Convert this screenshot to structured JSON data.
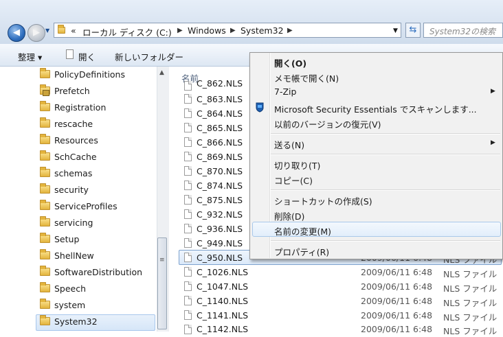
{
  "address": {
    "crumbs": [
      "«",
      "ローカル ディスク (C:)",
      "Windows",
      "System32"
    ],
    "search_placeholder": "System32の検索"
  },
  "toolbar": {
    "organize": "整理 ▾",
    "open": "開く",
    "new_folder": "新しいフォルダー"
  },
  "nav": {
    "items": [
      "PolicyDefinitions",
      "Prefetch",
      "Registration",
      "rescache",
      "Resources",
      "SchCache",
      "schemas",
      "security",
      "ServiceProfiles",
      "servicing",
      "Setup",
      "ShellNew",
      "SoftwareDistribution",
      "Speech",
      "system",
      "System32"
    ],
    "selected": "System32"
  },
  "files": {
    "column_name": "名前",
    "rows": [
      {
        "name": "C_862.NLS",
        "date": "",
        "type": ""
      },
      {
        "name": "C_863.NLS",
        "date": "",
        "type": ""
      },
      {
        "name": "C_864.NLS",
        "date": "",
        "type": ""
      },
      {
        "name": "C_865.NLS",
        "date": "",
        "type": ""
      },
      {
        "name": "C_866.NLS",
        "date": "",
        "type": ""
      },
      {
        "name": "C_869.NLS",
        "date": "",
        "type": ""
      },
      {
        "name": "C_870.NLS",
        "date": "",
        "type": ""
      },
      {
        "name": "C_874.NLS",
        "date": "",
        "type": ""
      },
      {
        "name": "C_875.NLS",
        "date": "",
        "type": ""
      },
      {
        "name": "C_932.NLS",
        "date": "",
        "type": ""
      },
      {
        "name": "C_936.NLS",
        "date": "",
        "type": ""
      },
      {
        "name": "C_949.NLS",
        "date": "",
        "type": ""
      },
      {
        "name": "C_950.NLS",
        "date": "2009/06/11 6:48",
        "type": "NLS ファイル"
      },
      {
        "name": "C_1026.NLS",
        "date": "2009/06/11 6:48",
        "type": "NLS ファイル"
      },
      {
        "name": "C_1047.NLS",
        "date": "2009/06/11 6:48",
        "type": "NLS ファイル"
      },
      {
        "name": "C_1140.NLS",
        "date": "2009/06/11 6:48",
        "type": "NLS ファイル"
      },
      {
        "name": "C_1141.NLS",
        "date": "2009/06/11 6:48",
        "type": "NLS ファイル"
      },
      {
        "name": "C_1142.NLS",
        "date": "2009/06/11 6:48",
        "type": "NLS ファイル"
      }
    ],
    "selected": "C_950.NLS"
  },
  "context_menu": {
    "items": [
      {
        "label": "開く(O)",
        "bold": true,
        "submenu": false
      },
      {
        "label": "メモ帳で開く(N)",
        "bold": false,
        "submenu": false
      },
      {
        "label": "7-Zip",
        "bold": false,
        "submenu": true
      },
      {
        "label": "Microsoft Security Essentials でスキャンします...",
        "bold": false,
        "submenu": false,
        "icon": "security-essentials-icon"
      },
      {
        "label": "以前のバージョンの復元(V)",
        "bold": false,
        "submenu": false
      },
      {
        "label": "送る(N)",
        "bold": false,
        "submenu": true
      },
      {
        "label": "切り取り(T)",
        "bold": false,
        "submenu": false
      },
      {
        "label": "コピー(C)",
        "bold": false,
        "submenu": false
      },
      {
        "label": "ショートカットの作成(S)",
        "bold": false,
        "submenu": false
      },
      {
        "label": "削除(D)",
        "bold": false,
        "submenu": false
      },
      {
        "label": "名前の変更(M)",
        "bold": false,
        "submenu": false
      },
      {
        "label": "プロパティ(R)",
        "bold": false,
        "submenu": false
      }
    ],
    "highlighted": "名前の変更(M)"
  }
}
